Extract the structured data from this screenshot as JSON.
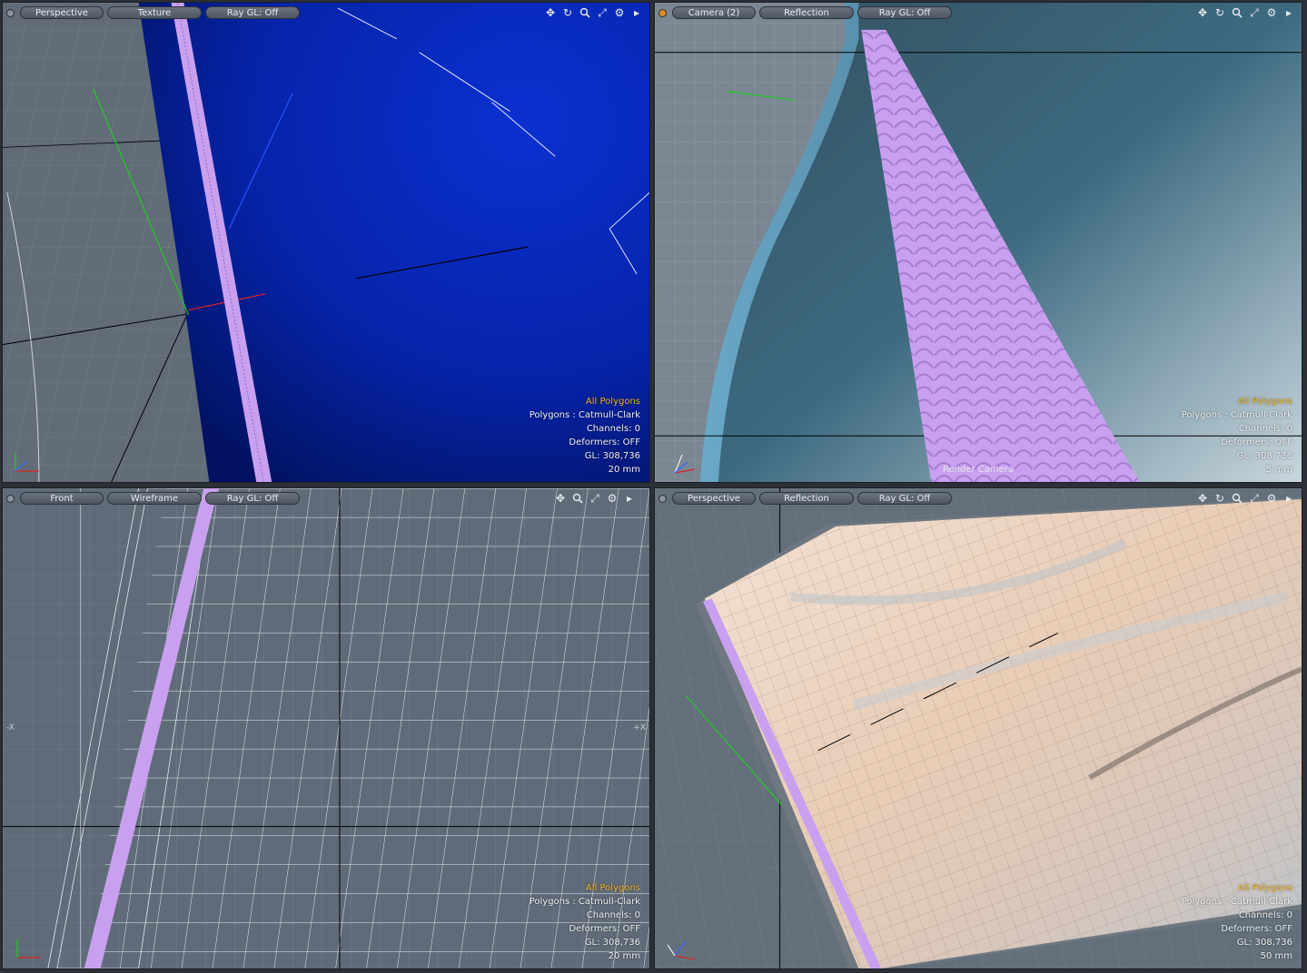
{
  "viewports": {
    "top_left": {
      "view": "Perspective",
      "shading": "Texture",
      "raygl": "Ray GL: Off",
      "info": {
        "selection": "All Polygons",
        "polygons": "Polygons : Catmull-Clark",
        "channels": "Channels: 0",
        "deformers": "Deformers: OFF",
        "gl": "GL: 308,736",
        "scale": "20 mm"
      }
    },
    "top_right": {
      "view": "Camera (2)",
      "shading": "Reflection",
      "raygl": "Ray GL: Off",
      "camera_label": "Render Camera",
      "info": {
        "selection": "All Polygons",
        "polygons": "Polygons : Catmull-Clark",
        "channels": "Channels: 0",
        "deformers": "Deformers: OFF",
        "gl": "GL: 308,736",
        "scale": "5 mm"
      }
    },
    "bottom_left": {
      "view": "Front",
      "shading": "Wireframe",
      "raygl": "Ray GL: Off",
      "axis_left": "-X",
      "axis_right": "+X",
      "info": {
        "selection": "All Polygons",
        "polygons": "Polygons : Catmull-Clark",
        "channels": "Channels: 0",
        "deformers": "Deformers: OFF",
        "gl": "GL: 308,736",
        "scale": "20 mm"
      }
    },
    "bottom_right": {
      "view": "Perspective",
      "shading": "Reflection",
      "raygl": "Ray GL: Off",
      "info": {
        "selection": "All Polygons",
        "polygons": "Polygons : Catmull-Clark",
        "channels": "Channels: 0",
        "deformers": "Deformers: OFF",
        "gl": "GL: 308,736",
        "scale": "50 mm"
      }
    }
  },
  "icons": [
    "move-icon",
    "rotate-icon",
    "zoom-icon",
    "maximize-icon",
    "gear-icon",
    "expand-arrow-icon"
  ],
  "colors": {
    "selection_highlight": "#f5b52a",
    "strip_lavender": "#c9a0f0",
    "mesh_blue": "#0a2ec8",
    "mesh_teal": "#3c5a70",
    "mesh_skin": "#e8cdb8",
    "active_dot": "#e08d22"
  }
}
